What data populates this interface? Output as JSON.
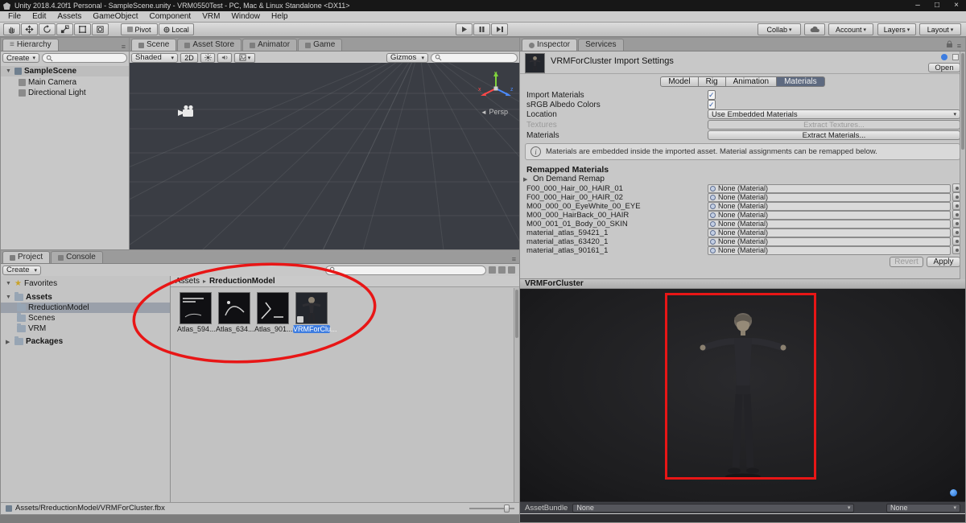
{
  "window": {
    "title": "Unity 2018.4.20f1 Personal - SampleScene.unity - VRM0550Test - PC, Mac & Linux Standalone <DX11>"
  },
  "menubar": {
    "items": [
      "File",
      "Edit",
      "Assets",
      "GameObject",
      "Component",
      "VRM",
      "Window",
      "Help"
    ]
  },
  "toolbar": {
    "pivot": "Pivot",
    "local": "Local",
    "collab": "Collab",
    "account": "Account",
    "layers": "Layers",
    "layout": "Layout"
  },
  "hierarchy": {
    "tab": "Hierarchy",
    "create_label": "Create",
    "scene_name": "SampleScene",
    "items": [
      "Main Camera",
      "Directional Light"
    ]
  },
  "scene_view": {
    "tabs": [
      "Scene",
      "Asset Store",
      "Animator",
      "Game"
    ],
    "shading_mode": "Shaded",
    "toggle_2d": "2D",
    "gizmos_label": "Gizmos",
    "persp_label": "Persp",
    "axis": {
      "x": "x",
      "y": "y",
      "z": "z"
    }
  },
  "project": {
    "tabs": [
      "Project",
      "Console"
    ],
    "create_label": "Create",
    "favorites_label": "Favorites",
    "assets_root": "Assets",
    "folders": [
      "RreductionModel",
      "Scenes",
      "VRM"
    ],
    "packages_label": "Packages",
    "breadcrumb": {
      "root": "Assets",
      "separator": "▸",
      "current": "RreductionModel"
    },
    "items": [
      {
        "label": "Atlas_594..."
      },
      {
        "label": "Atlas_634..."
      },
      {
        "label": "Atlas_901..."
      },
      {
        "label": "VRMForClu..."
      }
    ],
    "status_path": "Assets/RreductionModel/VRMForCluster.fbx"
  },
  "inspector": {
    "tabs": [
      "Inspector",
      "Services"
    ],
    "title": "VRMForCluster Import Settings",
    "open_label": "Open",
    "mode_tabs": [
      "Model",
      "Rig",
      "Animation",
      "Materials"
    ],
    "fields": {
      "import_materials": "Import Materials",
      "srgb": "sRGB Albedo Colors",
      "location_label": "Location",
      "location_value": "Use Embedded Materials",
      "textures_label": "Textures",
      "extract_textures": "Extract Textures...",
      "materials_label": "Materials",
      "extract_materials": "Extract Materials..."
    },
    "info_text": "Materials are embedded inside the imported asset. Material assignments can be remapped below.",
    "remapped_header": "Remapped Materials",
    "on_demand": "On Demand Remap",
    "material_slots": [
      "F00_000_Hair_00_HAIR_01",
      "F00_000_Hair_00_HAIR_02",
      "M00_000_00_EyeWhite_00_EYE",
      "M00_000_HairBack_00_HAIR",
      "M00_001_01_Body_00_SKIN",
      "material_atlas_59421_1",
      "material_atlas_63420_1",
      "material_atlas_90161_1"
    ],
    "none_value": "None (Material)",
    "revert_label": "Revert",
    "apply_label": "Apply",
    "preview_title": "VRMForCluster",
    "assetbundle_label": "AssetBundle",
    "assetbundle_value": "None",
    "assetbundle_variant": "None"
  },
  "colors": {
    "annotation_red": "#e81616",
    "selection_blue": "#3e7de0"
  }
}
